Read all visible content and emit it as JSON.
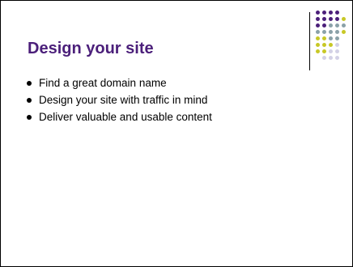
{
  "slide": {
    "title": "Design your site",
    "bullets": [
      "Find a great domain name",
      "Design your site with traffic in mind",
      "Deliver valuable and usable content"
    ]
  },
  "decoration": {
    "icon": "dot-grid-ornament",
    "colors": {
      "purple": "#4b1f7a",
      "gray": "#8aa1a8",
      "olive": "#c8c826",
      "lavender": "#d3d1e6"
    },
    "rows": [
      [
        "purple",
        "purple",
        "purple",
        "purple",
        null
      ],
      [
        "purple",
        "purple",
        "purple",
        "purple",
        "olive"
      ],
      [
        "purple",
        "purple",
        "gray",
        "gray",
        "gray"
      ],
      [
        "gray",
        "gray",
        "gray",
        "gray",
        "olive"
      ],
      [
        "olive",
        "olive",
        "gray",
        "gray",
        null
      ],
      [
        "olive",
        "olive",
        "olive",
        "lavender",
        null
      ],
      [
        "olive",
        "olive",
        "lavender",
        "lavender",
        null
      ],
      [
        null,
        "lavender",
        "lavender",
        "lavender",
        null
      ]
    ]
  },
  "colors": {
    "title": "#4b1f7a",
    "text": "#000000",
    "border": "#000000"
  }
}
